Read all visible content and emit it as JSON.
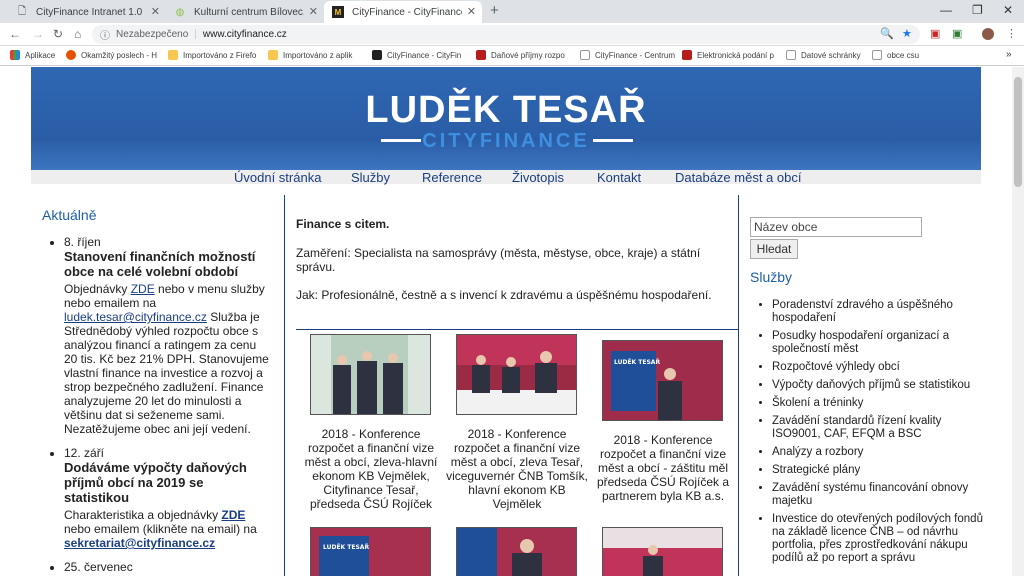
{
  "browser": {
    "tabs": [
      {
        "title": "CityFinance Intranet 1.0",
        "icon": "page-icon"
      },
      {
        "title": "Kulturní centrum Bílovec, příspěvková organizace",
        "icon": "kcb-icon"
      },
      {
        "title": "CityFinance - CityFinance - Progra",
        "icon": "cf-icon"
      }
    ],
    "new_tab": "+",
    "url_security": "Nezabezpečeno",
    "url": "www.cityfinance.cz",
    "bookmarks": [
      {
        "label": "Aplikace",
        "color": "#e53935"
      },
      {
        "label": "Okamžitý poslech - H",
        "color": "#e65100"
      },
      {
        "label": "Importováno z Firefo",
        "color": "#f9c74f"
      },
      {
        "label": "Importováno z aplik",
        "color": "#f9c74f"
      },
      {
        "label": "CityFinance - CityFin",
        "color": "#222222"
      },
      {
        "label": "Daňové příjmy rozpo",
        "color": "#b71c1c"
      },
      {
        "label": "CityFinance - Centrum",
        "color": "#dddddd"
      },
      {
        "label": "Elektronická podání p",
        "color": "#b71c1c"
      },
      {
        "label": "Datové schránky",
        "color": "#dddddd"
      },
      {
        "label": "obce csu",
        "color": "#dddddd"
      }
    ]
  },
  "banner": {
    "name": "LUDĚK TESAŘ",
    "sub": "CITYFINANCE"
  },
  "menu": [
    "Úvodní stránka",
    "Služby",
    "Reference",
    "Životopis",
    "Kontakt",
    "Databáze měst a obcí"
  ],
  "left": {
    "title": "Aktuálně",
    "news": [
      {
        "date": "8. říjen",
        "headline": "Stanovení finančních možností obce na celé volební období",
        "p1": "Objednávky ",
        "link1": "ZDE",
        "p2": " nebo v menu služby nebo emailem na ",
        "link2": "ludek.tesar@cityfinance.cz",
        "p3": " Služba je Střednědobý výhled rozpočtu obce s analýzou financí a ratingem za cenu 20 tis. Kč bez 21% DPH. Stanovujeme vlastní finance na investice a rozvoj a strop bezpečného zadlužení. Finance analyzujeme 20 let do minulosti a většinu dat si seženeme sami. Nezatěžujeme obec ani její vedení."
      },
      {
        "date": "12. září",
        "headline": "Dodáváme výpočty daňových příjmů obcí na 2019 se statistikou",
        "p1": "Charakteristika a objednávky ",
        "link1": "ZDE",
        "p2": " nebo emailem (klikněte na email) na ",
        "link2": "sekretariat@cityfinance.cz",
        "p3": ""
      },
      {
        "date": "25. červenec",
        "headline": "",
        "p1": "",
        "link1": "",
        "p2": "",
        "link2": "",
        "p3": ""
      }
    ]
  },
  "center": {
    "title": "Finance s citem.",
    "line1": "Zaměření: Specialista na samosprávy (města, městyse, obce, kraje) a státní správu.",
    "line2": "Jak: Profesionálně, čestně a s invencí k zdravému a úspěšnému hospodaření.",
    "photos": [
      {
        "caption": "2018 - Konference rozpočet a finanční vize měst a obcí, zleva-hlavní ekonom KB Vejmělek, Cityfinance Tesař, předseda ČSÚ Rojíček"
      },
      {
        "caption": "2018 - Konference rozpočet a finanční vize měst a obcí, zleva Tesař, viceguvernér ČNB Tomšík, hlavní ekonom KB Vejmělek"
      },
      {
        "caption": "2018 - Konference rozpočet a finanční vize měst a obcí - záštitu měl předseda ČSÚ Rojíček a partnerem byla KB a.s."
      }
    ]
  },
  "right": {
    "search_placeholder": "Název obce",
    "search_button": "Hledat",
    "title": "Služby",
    "services": [
      "Poradenství zdravého a úspěšného hospodaření",
      "Posudky hospodaření organizací a společností měst",
      "Rozpočtové výhledy obcí",
      "Výpočty daňových příjmů se statistikou",
      "Školení a tréninky",
      "Zavádění standardů řízení kvality ISO9001, CAF, EFQM a BSC",
      "Analýzy a rozbory",
      "Strategické plány",
      "Zavádění systému financování obnovy majetku",
      "Investice do otevřených podílových fondů na základě licence ČNB – od návrhu portfolia, přes zprostředkování nákupu podílů až po report a správu"
    ]
  }
}
